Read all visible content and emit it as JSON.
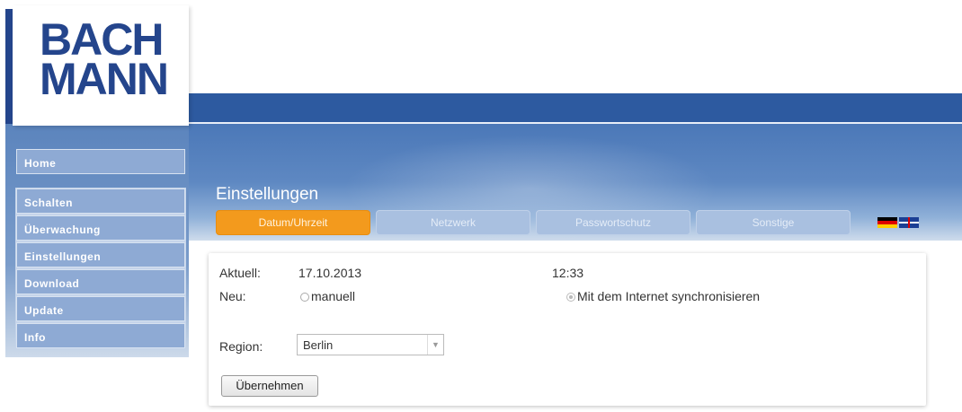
{
  "brand": {
    "logo_line1": "BACH",
    "logo_line2": "MANN",
    "color": "#24458c"
  },
  "sidebar": {
    "items": [
      {
        "label": "Home"
      },
      {
        "label": "Schalten"
      },
      {
        "label": "Überwachung"
      },
      {
        "label": "Einstellungen"
      },
      {
        "label": "Download"
      },
      {
        "label": "Update"
      },
      {
        "label": "Info"
      }
    ]
  },
  "header": {
    "title": "Einstellungen",
    "tabs": [
      {
        "label": "Datum/Uhrzeit",
        "active": true
      },
      {
        "label": "Netzwerk",
        "active": false
      },
      {
        "label": "Passwortschutz",
        "active": false
      },
      {
        "label": "Sonstige",
        "active": false
      }
    ],
    "languages": [
      "de-flag-icon",
      "uk-flag-icon"
    ],
    "active_tab_color": "#f39a1d"
  },
  "datetime": {
    "current_label": "Aktuell:",
    "current_date": "17.10.2013",
    "current_time": "12:33",
    "new_label": "Neu:",
    "option_manual": "manuell",
    "option_sync": "Mit dem Internet synchronisieren",
    "selected_option": "sync",
    "region_label": "Region:",
    "region_value": "Berlin",
    "apply_button": "Übernehmen"
  }
}
